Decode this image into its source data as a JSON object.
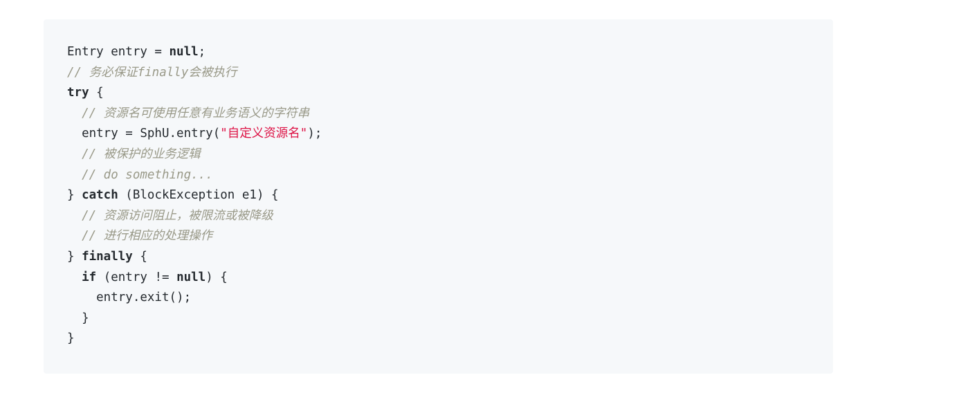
{
  "code": {
    "lines": [
      [
        {
          "t": "Entry entry = ",
          "c": "plain"
        },
        {
          "t": "null",
          "c": "kw"
        },
        {
          "t": ";",
          "c": "plain"
        }
      ],
      [
        {
          "t": "// 务必保证finally会被执行",
          "c": "cmt"
        }
      ],
      [
        {
          "t": "try",
          "c": "kw"
        },
        {
          "t": " {",
          "c": "plain"
        }
      ],
      [
        {
          "t": "  ",
          "c": "plain"
        },
        {
          "t": "// 资源名可使用任意有业务语义的字符串",
          "c": "cmt"
        }
      ],
      [
        {
          "t": "  entry = SphU.entry(",
          "c": "plain"
        },
        {
          "t": "\"自定义资源名\"",
          "c": "str"
        },
        {
          "t": ");",
          "c": "plain"
        }
      ],
      [
        {
          "t": "  ",
          "c": "plain"
        },
        {
          "t": "// 被保护的业务逻辑",
          "c": "cmt"
        }
      ],
      [
        {
          "t": "  ",
          "c": "plain"
        },
        {
          "t": "// do something...",
          "c": "cmt"
        }
      ],
      [
        {
          "t": "} ",
          "c": "plain"
        },
        {
          "t": "catch",
          "c": "kw"
        },
        {
          "t": " (BlockException e1) {",
          "c": "plain"
        }
      ],
      [
        {
          "t": "  ",
          "c": "plain"
        },
        {
          "t": "// 资源访问阻止，被限流或被降级",
          "c": "cmt"
        }
      ],
      [
        {
          "t": "  ",
          "c": "plain"
        },
        {
          "t": "// 进行相应的处理操作",
          "c": "cmt"
        }
      ],
      [
        {
          "t": "} ",
          "c": "plain"
        },
        {
          "t": "finally",
          "c": "kw"
        },
        {
          "t": " {",
          "c": "plain"
        }
      ],
      [
        {
          "t": "  ",
          "c": "plain"
        },
        {
          "t": "if",
          "c": "kw"
        },
        {
          "t": " (entry != ",
          "c": "plain"
        },
        {
          "t": "null",
          "c": "kw"
        },
        {
          "t": ") {",
          "c": "plain"
        }
      ],
      [
        {
          "t": "    entry.exit();",
          "c": "plain"
        }
      ],
      [
        {
          "t": "  }",
          "c": "plain"
        }
      ],
      [
        {
          "t": "}",
          "c": "plain"
        }
      ]
    ]
  }
}
